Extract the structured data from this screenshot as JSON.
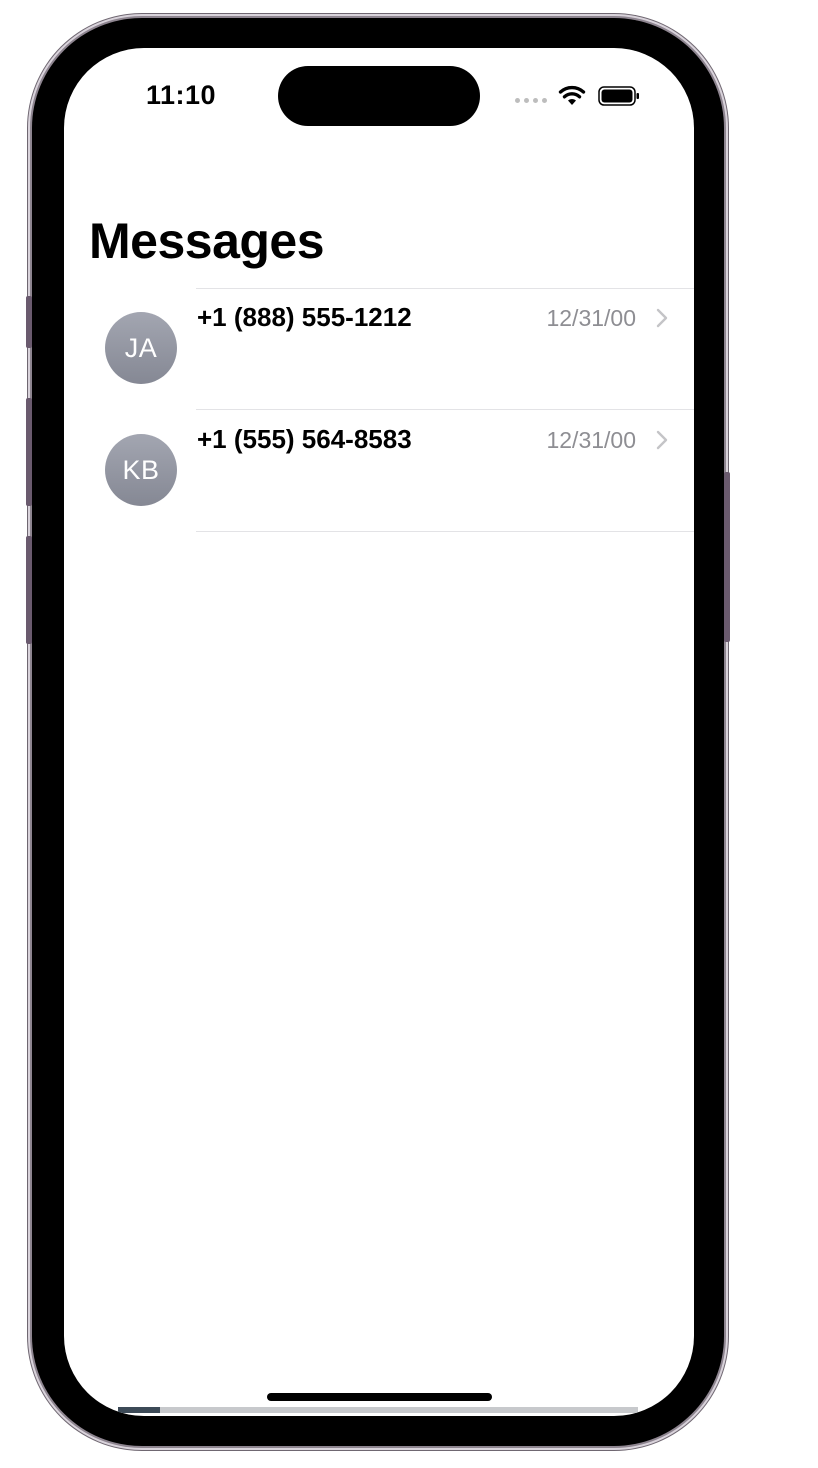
{
  "status_bar": {
    "time": "11:10",
    "icons": [
      "cellular-signal-icon",
      "wifi-icon",
      "battery-icon"
    ]
  },
  "screen": {
    "title": "Messages"
  },
  "conversations": [
    {
      "initials": "JA",
      "phone": "+1 (888) 555-1212",
      "date": "12/31/00"
    },
    {
      "initials": "KB",
      "phone": "+1 (555) 564-8583",
      "date": "12/31/00"
    }
  ],
  "colors": {
    "avatar_top": "#a3a6b1",
    "avatar_bottom": "#858894",
    "secondary_text": "#8e8e93",
    "separator": "#e3e3e6"
  }
}
